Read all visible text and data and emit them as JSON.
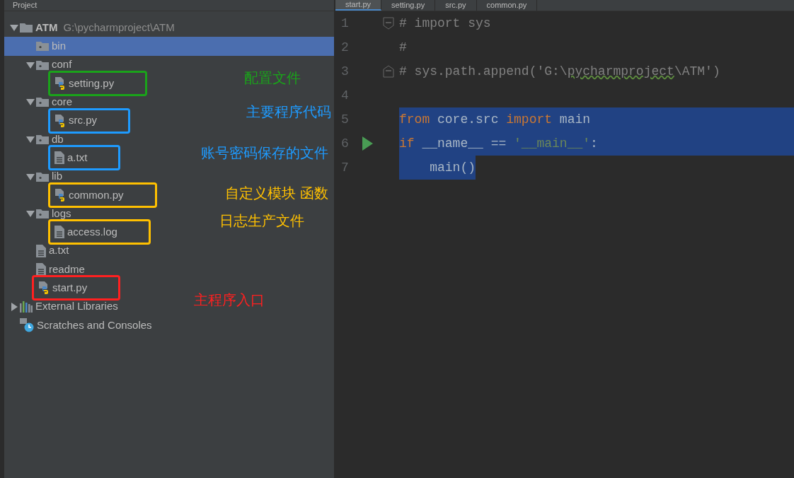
{
  "project_panel": {
    "title": "Project"
  },
  "tree": [
    {
      "name": "ATM",
      "path": "G:\\pycharmproject\\ATM",
      "kind": "root",
      "expanded": true,
      "selected": false,
      "children": [
        {
          "name": "bin",
          "kind": "folder",
          "selected": true
        },
        {
          "name": "conf",
          "kind": "folder",
          "expanded": true,
          "selected": false,
          "children": [
            {
              "name": "setting.py",
              "kind": "python",
              "selected": false,
              "color": "#1aa31a"
            }
          ]
        },
        {
          "name": "core",
          "kind": "folder",
          "expanded": true,
          "selected": false,
          "children": [
            {
              "name": "src.py",
              "kind": "python",
              "selected": false,
              "color": "#1e9bff"
            }
          ]
        },
        {
          "name": "db",
          "kind": "folder",
          "expanded": true,
          "selected": false,
          "children": [
            {
              "name": "a.txt",
              "kind": "text",
              "selected": false,
              "color": "#1e9bff"
            }
          ]
        },
        {
          "name": "lib",
          "kind": "folder",
          "expanded": true,
          "selected": false,
          "children": [
            {
              "name": "common.py",
              "kind": "python",
              "selected": false,
              "color": "#ffc000"
            }
          ]
        },
        {
          "name": "logs",
          "kind": "folder",
          "expanded": true,
          "selected": false,
          "children": [
            {
              "name": "access.log",
              "kind": "text",
              "selected": false,
              "color": "#ffc000"
            }
          ]
        },
        {
          "name": "a.txt",
          "kind": "text",
          "selected": false
        },
        {
          "name": "readme",
          "kind": "text",
          "selected": false
        },
        {
          "name": "start.py",
          "kind": "python",
          "selected": false,
          "color": "#ff2020"
        }
      ]
    },
    {
      "name": "External Libraries",
      "kind": "libraries",
      "expanded": false,
      "selected": false
    },
    {
      "name": "Scratches and Consoles",
      "kind": "scratches",
      "selected": false
    }
  ],
  "annotations": [
    {
      "text": "配置文件",
      "color": "#1aa31a"
    },
    {
      "text": "主要程序代码",
      "color": "#1e9bff"
    },
    {
      "text": "账号密码保存的文件",
      "color": "#1e9bff"
    },
    {
      "text": "自定义模块 函数",
      "color": "#ffc000"
    },
    {
      "text": "日志生产文件",
      "color": "#ffc000"
    },
    {
      "text": "主程序入口",
      "color": "#ff2020"
    }
  ],
  "tabs": [
    {
      "label": "start.py",
      "selected": true
    },
    {
      "label": "setting.py",
      "selected": false
    },
    {
      "label": "src.py",
      "selected": false
    },
    {
      "label": "common.py",
      "selected": false
    }
  ],
  "code": [
    {
      "number": "1",
      "fold_start": true,
      "fold_end": false,
      "run": false,
      "selected": false,
      "tokens": [
        {
          "kind": "comment",
          "text": "# import sys"
        }
      ]
    },
    {
      "number": "2",
      "fold_start": false,
      "fold_end": false,
      "run": false,
      "selected": false,
      "tokens": [
        {
          "kind": "comment",
          "text": "#"
        }
      ]
    },
    {
      "number": "3",
      "fold_start": false,
      "fold_end": true,
      "run": false,
      "selected": false,
      "tokens": [
        {
          "kind": "comment",
          "text": "# sys.path.append('G:\\"
        },
        {
          "kind": "typo",
          "text": "pycharmproject"
        },
        {
          "kind": "comment",
          "text": "\\ATM')"
        }
      ]
    },
    {
      "number": "4",
      "fold_start": false,
      "fold_end": false,
      "run": false,
      "selected": false
    },
    {
      "number": "5",
      "fold_start": false,
      "fold_end": false,
      "run": false,
      "selected": true,
      "tokens": [
        {
          "kind": "keyword",
          "text": "from"
        },
        {
          "kind": "plain",
          "text": " core.src "
        },
        {
          "kind": "keyword",
          "text": "import"
        },
        {
          "kind": "plain",
          "text": " main"
        }
      ]
    },
    {
      "number": "6",
      "fold_start": false,
      "fold_end": false,
      "run": true,
      "selected": true,
      "tokens": [
        {
          "kind": "keyword",
          "text": "if"
        },
        {
          "kind": "plain",
          "text": " __name__ == "
        },
        {
          "kind": "string",
          "text": "'__main__'"
        },
        {
          "kind": "plain",
          "text": ":"
        }
      ]
    },
    {
      "number": "7",
      "fold_start": false,
      "fold_end": false,
      "run": false,
      "selected": true,
      "tokens": [
        {
          "kind": "plain",
          "text": "    main()"
        }
      ]
    }
  ]
}
